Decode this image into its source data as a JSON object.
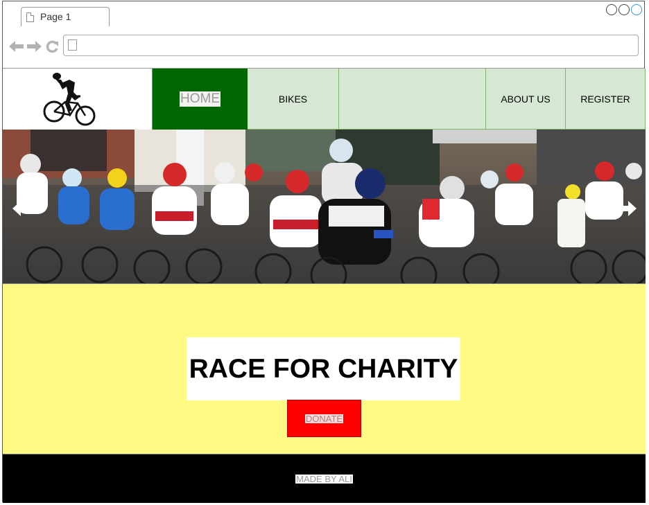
{
  "browser": {
    "tab_label": "Page 1",
    "nav_back_icon": "arrow-left-icon",
    "nav_forward_icon": "arrow-right-icon",
    "nav_reload_icon": "reload-icon",
    "address_value": ""
  },
  "site": {
    "logo_icon": "cyclist-logo-icon",
    "nav": {
      "home": "HOME",
      "bikes": "BIKES",
      "about": "ABOUT US",
      "register": "REGISTER"
    },
    "hero": {
      "image_subject": "cycling race peloton",
      "prev_icon": "arrow-left-icon",
      "next_icon": "arrow-right-icon"
    },
    "promo": {
      "title": "RACE FOR CHARITY",
      "donate_label": "DONATE"
    },
    "footer": {
      "text": "MADE BY ALI"
    },
    "colors": {
      "home_bg": "#006600",
      "nav_bg": "#d6e8d4",
      "nav_border": "#82b366",
      "promo_bg": "#fffa84",
      "donate_bg": "#ff0000",
      "footer_bg": "#000000"
    }
  }
}
